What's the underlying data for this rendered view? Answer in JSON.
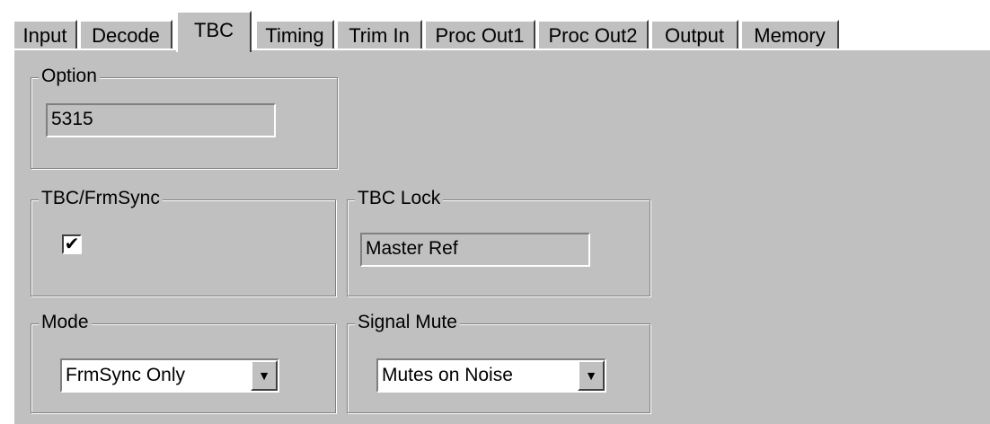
{
  "tabs": [
    "Input",
    "Decode",
    "TBC",
    "Timing",
    "Trim In",
    "Proc Out1",
    "Proc Out2",
    "Output",
    "Memory"
  ],
  "active_tab": "TBC",
  "option": {
    "title": "Option",
    "value": "5315"
  },
  "tbc_frmsync": {
    "title": "TBC/FrmSync",
    "checked": true,
    "check_glyph": "✔"
  },
  "tbc_lock": {
    "title": "TBC Lock",
    "value": "Master Ref"
  },
  "mode": {
    "title": "Mode",
    "selected": "FrmSync Only"
  },
  "signal_mute": {
    "title": "Signal Mute",
    "selected": "Mutes on Noise"
  },
  "icons": {
    "dropdown_arrow": "▼"
  },
  "colors": {
    "panel": "#c0c0c0",
    "field_bg": "#c0c0c0",
    "select_bg": "#ffffff"
  }
}
